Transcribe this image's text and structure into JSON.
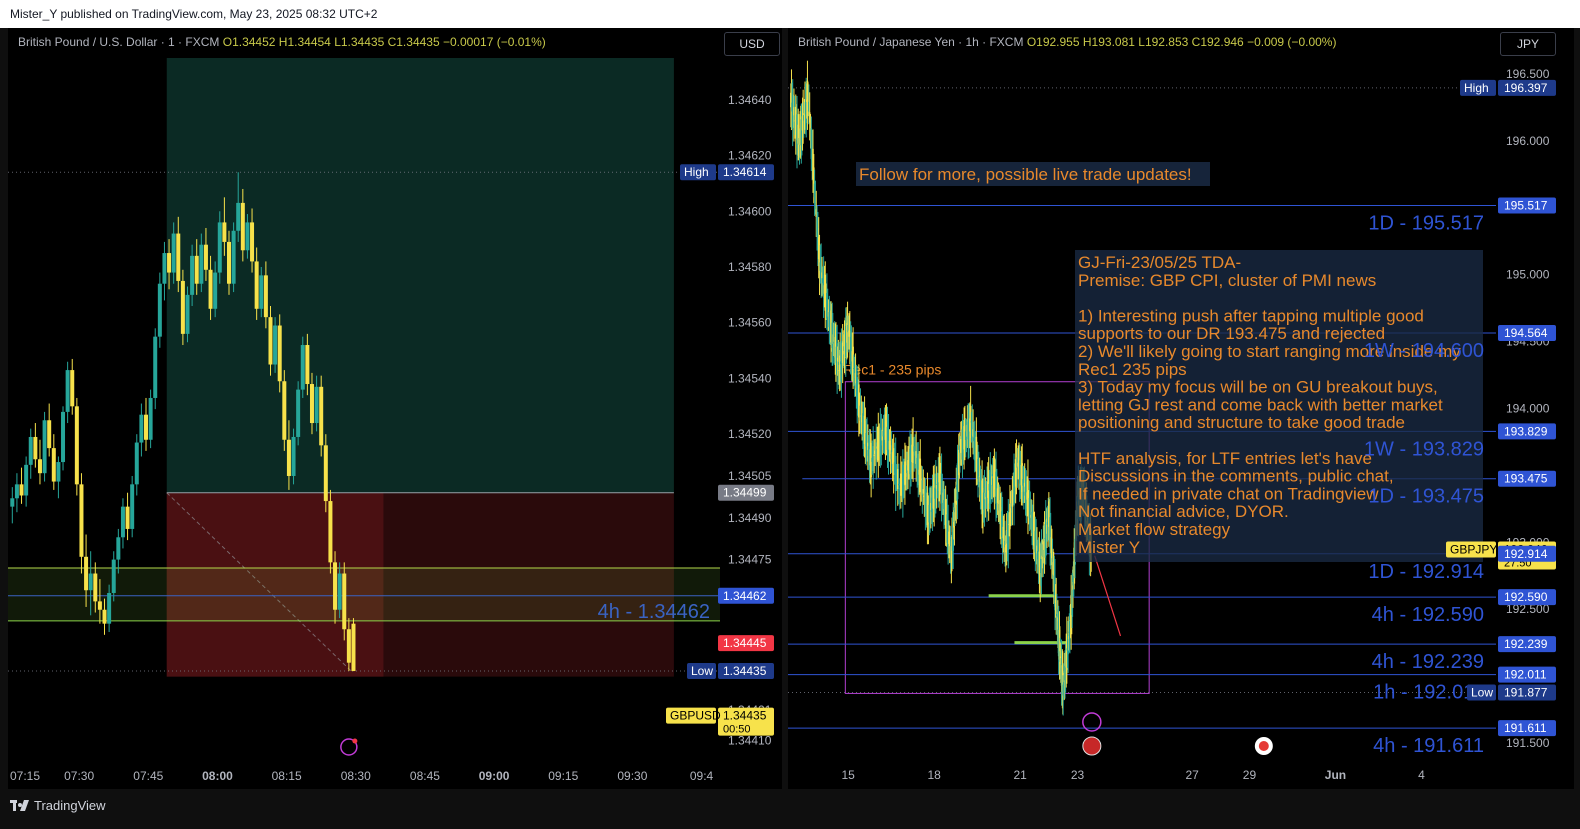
{
  "header": {
    "published": "Mister_Y published on TradingView.com, May 23, 2025 08:32 UTC+2"
  },
  "footer": {
    "brand": "TradingView"
  },
  "colors": {
    "up": "#26a69a",
    "down": "#f7e24b",
    "blue_line": "#2f54d4",
    "green_line": "#8bd24a",
    "annotation": "#e8892c",
    "profit_zone": "#0b2a24",
    "loss_zone": "#4a1012"
  },
  "chart_data": [
    {
      "type": "candlestick",
      "legend": {
        "symbol": "British Pound / U.S. Dollar · 1 · FXCM",
        "o": "O1.34452",
        "h": "H1.34454",
        "l": "L1.34435",
        "c": "C1.34435",
        "chg": "−0.00017 (−0.01%)"
      },
      "currency": "USD",
      "ylim": [
        1.34402,
        1.34655
      ],
      "y_ticks": [
        1.3464,
        1.3462,
        1.346,
        1.3458,
        1.3456,
        1.3454,
        1.3452,
        1.34505,
        1.3449,
        1.34475,
        1.34421,
        1.3441
      ],
      "y_tick_labels": [
        "1.34640",
        "1.34620",
        "1.34600",
        "1.34580",
        "1.34560",
        "1.34540",
        "1.34520",
        "1.34505",
        "1.34490",
        "1.34475",
        "1.34421",
        "1.34410"
      ],
      "x_ticks": [
        {
          "m": 0,
          "label": "07:15"
        },
        {
          "m": 15,
          "label": "07:30"
        },
        {
          "m": 30,
          "label": "07:45"
        },
        {
          "m": 45,
          "label": "08:00",
          "bold": true
        },
        {
          "m": 60,
          "label": "08:15"
        },
        {
          "m": 75,
          "label": "08:30"
        },
        {
          "m": 90,
          "label": "08:45"
        },
        {
          "m": 105,
          "label": "09:00",
          "bold": true
        },
        {
          "m": 120,
          "label": "09:15"
        },
        {
          "m": 135,
          "label": "09:30"
        },
        {
          "m": 150,
          "label": "09:4"
        }
      ],
      "x_range_minutes": [
        0,
        154
      ],
      "tags": [
        {
          "value": 1.34614,
          "label": "1.34614",
          "prefix": "High",
          "color": "#1e3a8a"
        },
        {
          "value": 1.34499,
          "label": "1.34499",
          "color": "#787b86"
        },
        {
          "value": 1.34462,
          "label": "1.34462",
          "color": "#2f54d4"
        },
        {
          "value": 1.34445,
          "label": "1.34445",
          "color": "#f23645"
        },
        {
          "value": 1.34435,
          "label": "1.34435",
          "prefix": "Low",
          "color": "#1e3a8a"
        },
        {
          "value": 1.34419,
          "label": "1.34435",
          "sub": "00:50",
          "prefix": "GBPUSD",
          "color": "#f7e24b",
          "dark": true
        }
      ],
      "levels": [
        {
          "value": 1.34614,
          "style": "dotted",
          "color": "#787b86"
        },
        {
          "value": 1.34435,
          "style": "dotted",
          "color": "#787b86"
        },
        {
          "value": 1.34462,
          "style": "solid",
          "color": "#2f54d4",
          "label": "4h - 1.34462"
        },
        {
          "value": 1.34472,
          "style": "solid",
          "color": "#b7d94a"
        },
        {
          "value": 1.34453,
          "style": "solid",
          "color": "#8bd24a"
        }
      ],
      "position": {
        "entry": 1.34499,
        "target": 1.34655,
        "stop": 1.34433,
        "start_minute": 34,
        "end_minute": 144,
        "stop_highlight_end": 81
      },
      "candles": [
        [
          0,
          1.34494,
          1.34501,
          1.34488,
          1.34497
        ],
        [
          1,
          1.34497,
          1.34506,
          1.34492,
          1.34502
        ],
        [
          2,
          1.34502,
          1.34508,
          1.34495,
          1.34498
        ],
        [
          3,
          1.34498,
          1.34512,
          1.34494,
          1.34509
        ],
        [
          4,
          1.34509,
          1.34522,
          1.34504,
          1.34519
        ],
        [
          5,
          1.34519,
          1.34524,
          1.34508,
          1.34511
        ],
        [
          6,
          1.34511,
          1.34518,
          1.34502,
          1.34506
        ],
        [
          7,
          1.34506,
          1.34528,
          1.34503,
          1.34525
        ],
        [
          8,
          1.34525,
          1.34531,
          1.34512,
          1.34515
        ],
        [
          9,
          1.34515,
          1.3452,
          1.345,
          1.34503
        ],
        [
          10,
          1.34503,
          1.34512,
          1.34497,
          1.3451
        ],
        [
          11,
          1.3451,
          1.3453,
          1.34507,
          1.34528
        ],
        [
          12,
          1.34528,
          1.34546,
          1.34524,
          1.34543
        ],
        [
          13,
          1.34543,
          1.34547,
          1.34527,
          1.3453
        ],
        [
          14,
          1.3453,
          1.34533,
          1.34498,
          1.34502
        ],
        [
          15,
          1.34502,
          1.34506,
          1.3447,
          1.34476
        ],
        [
          16,
          1.34476,
          1.34484,
          1.34458,
          1.34464
        ],
        [
          17,
          1.34464,
          1.34478,
          1.34455,
          1.3447
        ],
        [
          18,
          1.3447,
          1.34474,
          1.34456,
          1.3446
        ],
        [
          19,
          1.3446,
          1.34468,
          1.34452,
          1.34457
        ],
        [
          20,
          1.34457,
          1.34461,
          1.34448,
          1.34452
        ],
        [
          21,
          1.34452,
          1.34466,
          1.34449,
          1.34463
        ],
        [
          22,
          1.34463,
          1.34478,
          1.3446,
          1.34475
        ],
        [
          23,
          1.34475,
          1.34486,
          1.3447,
          1.34483
        ],
        [
          24,
          1.34483,
          1.34497,
          1.34479,
          1.34494
        ],
        [
          25,
          1.34494,
          1.34499,
          1.34482,
          1.34486
        ],
        [
          26,
          1.34486,
          1.34505,
          1.34483,
          1.34502
        ],
        [
          27,
          1.34502,
          1.3452,
          1.34498,
          1.34517
        ],
        [
          28,
          1.34517,
          1.34531,
          1.34512,
          1.34527
        ],
        [
          29,
          1.34527,
          1.34533,
          1.34514,
          1.34518
        ],
        [
          30,
          1.34518,
          1.34536,
          1.34515,
          1.34533
        ],
        [
          31,
          1.34533,
          1.34558,
          1.34529,
          1.34555
        ],
        [
          32,
          1.34555,
          1.34578,
          1.34551,
          1.34574
        ],
        [
          33,
          1.34574,
          1.34589,
          1.34568,
          1.34585
        ],
        [
          34,
          1.34585,
          1.3459,
          1.34572,
          1.34578
        ],
        [
          35,
          1.34578,
          1.34596,
          1.34574,
          1.34592
        ],
        [
          36,
          1.34592,
          1.34598,
          1.34571,
          1.34575
        ],
        [
          37,
          1.34575,
          1.34579,
          1.34552,
          1.34556
        ],
        [
          38,
          1.34556,
          1.34573,
          1.34553,
          1.3457
        ],
        [
          39,
          1.3457,
          1.34588,
          1.34566,
          1.34584
        ],
        [
          40,
          1.34584,
          1.3459,
          1.3457,
          1.34574
        ],
        [
          41,
          1.34574,
          1.34592,
          1.34571,
          1.34588
        ],
        [
          42,
          1.34588,
          1.34594,
          1.34575,
          1.34579
        ],
        [
          43,
          1.34579,
          1.34584,
          1.34561,
          1.34565
        ],
        [
          44,
          1.34565,
          1.34582,
          1.34562,
          1.34578
        ],
        [
          45,
          1.34578,
          1.346,
          1.34574,
          1.34596
        ],
        [
          46,
          1.34596,
          1.34605,
          1.34584,
          1.34589
        ],
        [
          47,
          1.34589,
          1.34593,
          1.3457,
          1.34574
        ],
        [
          48,
          1.34574,
          1.34596,
          1.34571,
          1.34593
        ],
        [
          49,
          1.34593,
          1.34614,
          1.34589,
          1.34603
        ],
        [
          50,
          1.34603,
          1.34608,
          1.34582,
          1.34586
        ],
        [
          51,
          1.34586,
          1.34599,
          1.34583,
          1.34596
        ],
        [
          52,
          1.34596,
          1.34601,
          1.34578,
          1.34582
        ],
        [
          53,
          1.34582,
          1.34587,
          1.34561,
          1.34565
        ],
        [
          54,
          1.34565,
          1.3458,
          1.34562,
          1.34577
        ],
        [
          55,
          1.34577,
          1.34582,
          1.34558,
          1.34562
        ],
        [
          56,
          1.34562,
          1.34566,
          1.34541,
          1.34545
        ],
        [
          57,
          1.34545,
          1.34562,
          1.34542,
          1.34559
        ],
        [
          58,
          1.34559,
          1.34563,
          1.34535,
          1.34539
        ],
        [
          59,
          1.34539,
          1.34543,
          1.34514,
          1.34518
        ],
        [
          60,
          1.34518,
          1.34525,
          1.345,
          1.34505
        ],
        [
          61,
          1.34505,
          1.34522,
          1.34502,
          1.34519
        ],
        [
          62,
          1.34519,
          1.34539,
          1.34516,
          1.34536
        ],
        [
          63,
          1.34536,
          1.34555,
          1.34533,
          1.34552
        ],
        [
          64,
          1.34552,
          1.34556,
          1.34534,
          1.34538
        ],
        [
          65,
          1.34538,
          1.34542,
          1.3452,
          1.34524
        ],
        [
          66,
          1.34524,
          1.34541,
          1.34521,
          1.34537
        ],
        [
          67,
          1.34537,
          1.34541,
          1.34512,
          1.34516
        ],
        [
          68,
          1.34516,
          1.3452,
          1.34492,
          1.34496
        ],
        [
          69,
          1.34496,
          1.345,
          1.3447,
          1.34474
        ],
        [
          70,
          1.34474,
          1.34478,
          1.34452,
          1.34457
        ],
        [
          71,
          1.34457,
          1.34474,
          1.34454,
          1.3447
        ],
        [
          72,
          1.3447,
          1.34474,
          1.34446,
          1.3445
        ],
        [
          73,
          1.3445,
          1.34454,
          1.34435,
          1.34438
        ],
        [
          74,
          1.34452,
          1.34454,
          1.34435,
          1.34435
        ]
      ]
    },
    {
      "type": "candlestick",
      "legend": {
        "symbol": "British Pound / Japanese Yen · 1h · FXCM",
        "o": "O192.955",
        "h": "H193.081",
        "l": "L192.853",
        "c": "C192.946",
        "chg": "−0.009 (−0.00%)"
      },
      "currency": "JPY",
      "ylim": [
        191.35,
        196.62
      ],
      "y_ticks": [
        196.5,
        196.0,
        195.0,
        194.5,
        194.0,
        193.0,
        192.5,
        191.5
      ],
      "y_tick_labels": [
        "196.500",
        "196.000",
        "195.000",
        "194.500",
        "194.000",
        "193.000",
        "192.500",
        "191.500"
      ],
      "x_ticks": [
        {
          "d": 15,
          "label": "15"
        },
        {
          "d": 18,
          "label": "18"
        },
        {
          "d": 21,
          "label": "21"
        },
        {
          "d": 23,
          "label": "23"
        },
        {
          "d": 27,
          "label": "27"
        },
        {
          "d": 29,
          "label": "29"
        },
        {
          "d": 32,
          "label": "Jun",
          "bold": true
        },
        {
          "d": 35,
          "label": "4"
        }
      ],
      "x_range_days": [
        12.9,
        37.6
      ],
      "tags": [
        {
          "value": 196.397,
          "label": "196.397",
          "prefix": "High",
          "color": "#1e3a8a"
        },
        {
          "value": 195.517,
          "label": "195.517",
          "color": "#2f54d4"
        },
        {
          "value": 194.564,
          "label": "194.564",
          "color": "#2f54d4"
        },
        {
          "value": 193.829,
          "label": "193.829",
          "color": "#2f54d4"
        },
        {
          "value": 193.475,
          "label": "193.475",
          "color": "#2f54d4"
        },
        {
          "value": 192.946,
          "label": "192.946",
          "sub": "27:50",
          "prefix": "GBPJPY",
          "color": "#f7e24b",
          "dark": true
        },
        {
          "value": 192.914,
          "label": "192.914",
          "color": "#2f54d4"
        },
        {
          "value": 192.59,
          "label": "192.590",
          "color": "#2f54d4"
        },
        {
          "value": 192.239,
          "label": "192.239",
          "color": "#2f54d4"
        },
        {
          "value": 192.011,
          "label": "192.011",
          "color": "#2f54d4"
        },
        {
          "value": 191.877,
          "label": "191.877",
          "prefix": "Low",
          "color": "#1e3a8a"
        },
        {
          "value": 191.611,
          "label": "191.611",
          "color": "#2f54d4"
        }
      ],
      "levels": [
        {
          "value": 196.397,
          "style": "dotted",
          "color": "#787b86"
        },
        {
          "value": 195.517,
          "style": "solid",
          "color": "#2f54d4",
          "label": "1D - 195.517"
        },
        {
          "value": 194.564,
          "style": "solid",
          "color": "#2f54d4",
          "label": "1W - 194.600"
        },
        {
          "value": 193.829,
          "style": "solid",
          "color": "#2f54d4",
          "label": "1W - 193.829"
        },
        {
          "value": 193.475,
          "style": "solid",
          "color": "#2f54d4",
          "label": "1D - 193.475",
          "start_day": 13.4
        },
        {
          "value": 192.914,
          "style": "solid",
          "color": "#2f54d4",
          "label": "1D - 192.914"
        },
        {
          "value": 192.59,
          "style": "solid",
          "color": "#2f54d4",
          "label": "4h - 192.590"
        },
        {
          "value": 192.239,
          "style": "solid",
          "color": "#2f54d4",
          "label": "4h - 192.239"
        },
        {
          "value": 192.011,
          "style": "solid",
          "color": "#2f54d4",
          "label": "1h - 192.011"
        },
        {
          "value": 191.877,
          "style": "dotted",
          "color": "#787b86"
        },
        {
          "value": 191.611,
          "style": "solid",
          "color": "#2f54d4",
          "label": "4h - 191.611"
        }
      ],
      "rectangle": {
        "label": "Rec1 - 235 pips",
        "top": 194.2,
        "bottom": 191.87,
        "start_day": 14.9,
        "end_day": 25.5,
        "color": "#b23fd1"
      },
      "green_segments": [
        {
          "value": 192.6,
          "start_day": 19.9,
          "end_day": 22.2
        },
        {
          "value": 192.25,
          "start_day": 20.8,
          "end_day": 22.6
        }
      ],
      "arrow": {
        "from_day": 23.6,
        "from_value": 192.9,
        "to_day": 24.5,
        "to_value": 192.3,
        "color": "#f23645"
      },
      "annotation_follow": "Follow for more, possible live trade updates!",
      "analysis_lines": [
        "GJ-Fri-23/05/25 TDA-",
        "Premise: GBP CPI, cluster of PMI news",
        "",
        "1) Interesting push after tapping multiple good",
        "supports to our DR 193.475 and rejected",
        "2) We'll likely going to start ranging more inside my",
        "Rec1 235 pips",
        "3) Today my focus will be on GU breakout buys,",
        "letting GJ rest and come back with better market",
        "positioning and structure to take good trade",
        "",
        "HTF analysis, for LTF entries let's have",
        "Discussions in the comments, public chat,",
        "If needed in private chat on Tradingview",
        "Not financial advice, DYOR.",
        "Market flow strategy",
        "Mister Y"
      ],
      "path": [
        [
          13.0,
          196.3
        ],
        [
          13.3,
          196.0
        ],
        [
          13.6,
          196.35
        ],
        [
          14.0,
          195.1
        ],
        [
          14.4,
          194.6
        ],
        [
          14.7,
          194.3
        ],
        [
          15.0,
          194.6
        ],
        [
          15.4,
          194.0
        ],
        [
          15.8,
          193.6
        ],
        [
          16.3,
          193.85
        ],
        [
          16.8,
          193.4
        ],
        [
          17.3,
          193.7
        ],
        [
          17.8,
          193.2
        ],
        [
          18.2,
          193.5
        ],
        [
          18.6,
          192.9
        ],
        [
          18.9,
          193.7
        ],
        [
          19.3,
          193.9
        ],
        [
          19.7,
          193.3
        ],
        [
          20.1,
          193.5
        ],
        [
          20.5,
          192.95
        ],
        [
          20.9,
          193.6
        ],
        [
          21.3,
          193.3
        ],
        [
          21.7,
          192.8
        ],
        [
          22.0,
          193.2
        ],
        [
          22.3,
          192.4
        ],
        [
          22.5,
          191.9
        ],
        [
          22.8,
          192.5
        ],
        [
          23.0,
          193.3
        ],
        [
          23.2,
          193.4
        ],
        [
          23.5,
          192.9
        ]
      ]
    }
  ]
}
